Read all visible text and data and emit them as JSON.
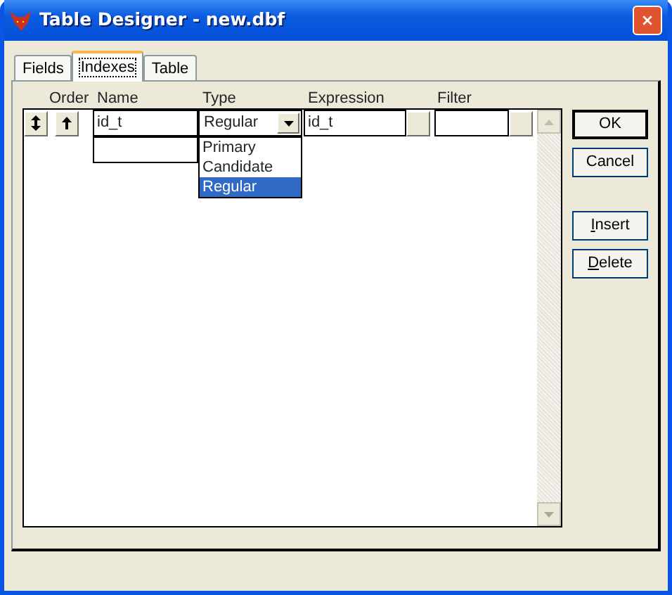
{
  "window": {
    "title": "Table Designer - new.dbf"
  },
  "tabs": [
    {
      "label": "Fields",
      "selected": false
    },
    {
      "label": "Indexes",
      "selected": true
    },
    {
      "label": "Table",
      "selected": false
    }
  ],
  "columns": [
    "Order",
    "Name",
    "Type",
    "Expression",
    "Filter"
  ],
  "rows": [
    {
      "kind": "index",
      "name": "id_t",
      "type": "Regular",
      "expression": "id_t"
    },
    {
      "kind": "new"
    }
  ],
  "type_dropdown": {
    "expanded": true,
    "options": [
      {
        "label": "Primary",
        "selected": false
      },
      {
        "label": "Candidate",
        "selected": false
      },
      {
        "label": "Regular",
        "selected": true
      }
    ]
  },
  "buttons": [
    {
      "label": "OK",
      "default": true,
      "mnemonic": false
    },
    {
      "label": "Cancel",
      "default": false,
      "mnemonic": false
    },
    {
      "label": "Insert",
      "default": false,
      "mnemonic": true
    },
    {
      "label": "Delete",
      "default": false,
      "mnemonic": true
    }
  ]
}
